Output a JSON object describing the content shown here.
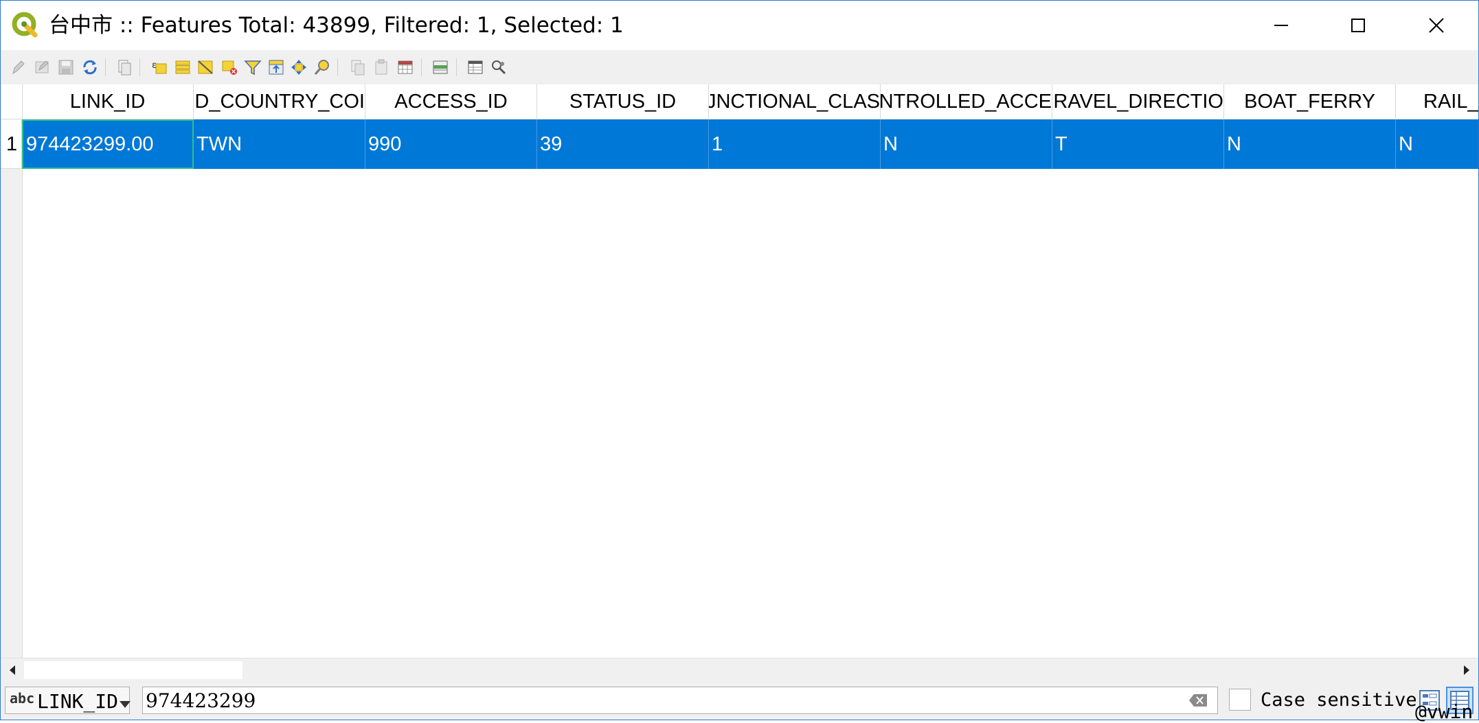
{
  "window": {
    "title": "台中市 :: Features Total: 43899, Filtered: 1, Selected: 1",
    "icon": "qgis-logo-icon",
    "controls": [
      "minimize-icon",
      "maximize-icon",
      "close-icon"
    ]
  },
  "toolbar": {
    "buttons": [
      "toggle-editing-icon",
      "toggle-multi-edit-icon",
      "save-edits-icon",
      "reload-table-icon",
      "add-feature-icon",
      "select-by-expression-icon",
      "select-all-icon",
      "invert-selection-icon",
      "deselect-all-icon",
      "filter-select-icon",
      "move-selection-top-icon",
      "pan-to-selection-icon",
      "zoom-to-selection-icon",
      "copy-rows-icon",
      "paste-features-icon",
      "delete-field-icon",
      "field-calculator-icon",
      "conditional-formatting-icon",
      "dock-table-icon",
      "actions-icon"
    ]
  },
  "table": {
    "columns": [
      "LINK_ID",
      "ISO_COUNTRY_CODE",
      "ACCESS_ID",
      "STATUS_ID",
      "FUNCTIONAL_CLASS",
      "CONTROLLED_ACCESS",
      "TRAVEL_DIRECTION",
      "BOAT_FERRY",
      "RAIL_FERRY"
    ],
    "columns_display": [
      "LINK_ID",
      "D_COUNTRY_COI",
      "ACCESS_ID",
      "STATUS_ID",
      "JNCTIONAL_CLAS",
      "NTROLLED_ACCE",
      "RAVEL_DIRECTIO",
      "BOAT_FERRY",
      "RAIL_"
    ],
    "rows": [
      {
        "row_number": "1",
        "cells": [
          "974423299.00",
          "TWN",
          "990",
          "39",
          "1",
          "N",
          "T",
          "N",
          "N"
        ]
      }
    ],
    "selection_color": "#0078d7"
  },
  "filter_bar": {
    "field_type_label": "abc",
    "field_name": "LINK_ID",
    "search_value": "974423299",
    "case_sensitive_label": "Case sensitive",
    "case_sensitive_checked": false,
    "view_buttons": [
      "form-view-icon",
      "table-view-icon"
    ]
  },
  "overlay_text": "@vwin"
}
